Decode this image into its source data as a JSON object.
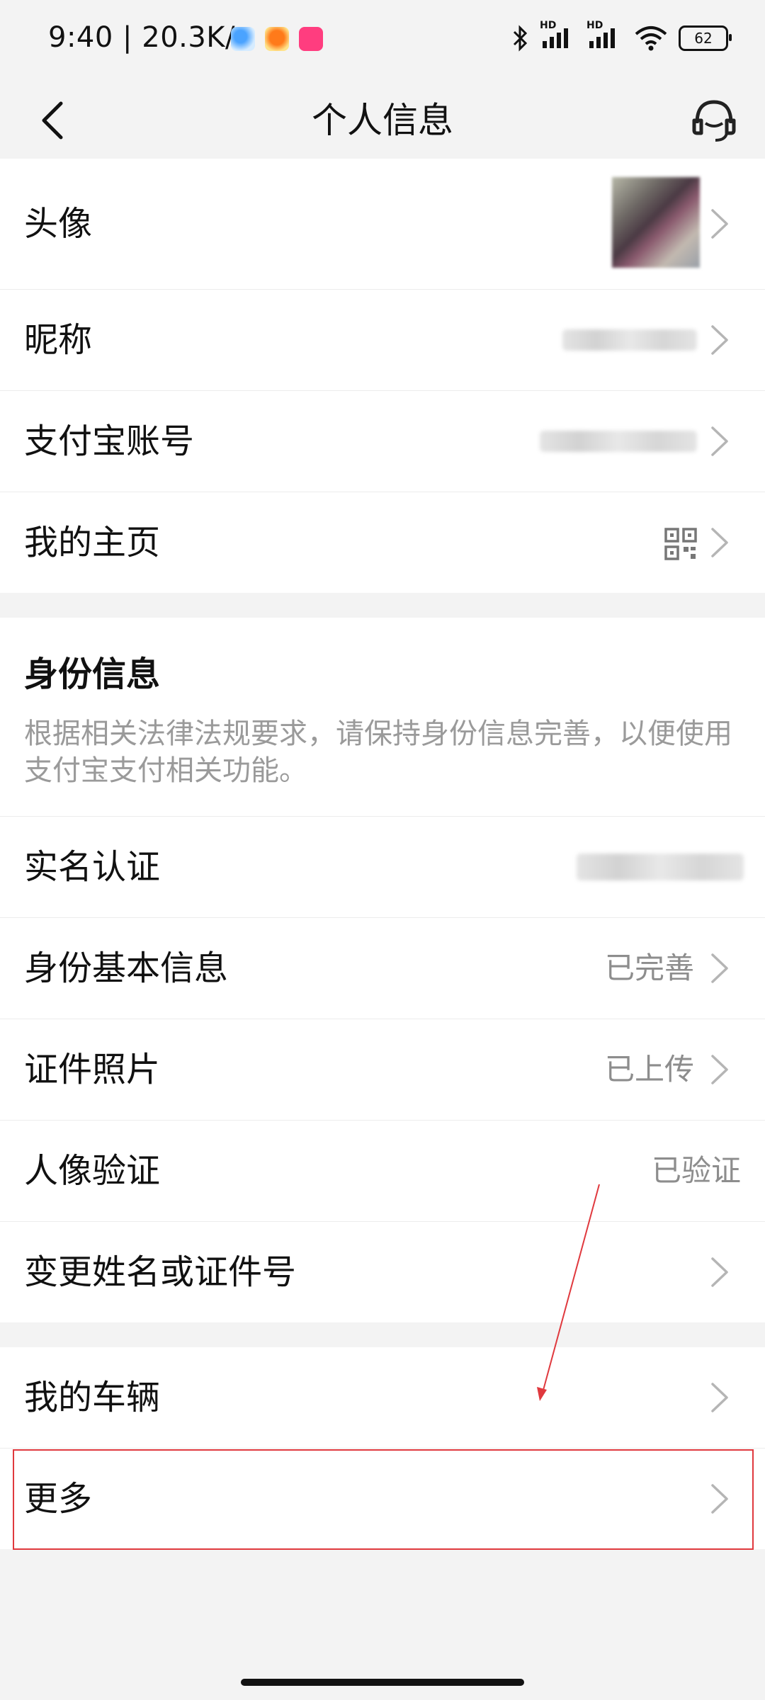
{
  "status_bar": {
    "time": "9:40",
    "speed": "| 20.3K/s",
    "network_labels": [
      "HD",
      "HD"
    ],
    "battery": "62"
  },
  "header": {
    "title": "个人信息",
    "back_icon": "chevron-left-icon",
    "service_icon": "headset-icon"
  },
  "profile": {
    "rows": [
      {
        "label": "头像"
      },
      {
        "label": "昵称"
      },
      {
        "label": "支付宝账号"
      },
      {
        "label": "我的主页"
      }
    ]
  },
  "identity": {
    "title": "身份信息",
    "description": "根据相关法律法规要求，请保持身份信息完善，以便使用支付宝支付相关功能。",
    "rows": [
      {
        "label": "实名认证",
        "value": ""
      },
      {
        "label": "身份基本信息",
        "value": "已完善"
      },
      {
        "label": "证件照片",
        "value": "已上传"
      },
      {
        "label": "人像验证",
        "value": "已验证"
      },
      {
        "label": "变更姓名或证件号",
        "value": ""
      }
    ]
  },
  "other": {
    "rows": [
      {
        "label": "我的车辆"
      },
      {
        "label": "更多"
      }
    ]
  },
  "colors": {
    "background": "#f3f3f3",
    "card": "#ffffff",
    "annotation_red": "#e0393e",
    "secondary_text": "#8d8d8d"
  }
}
